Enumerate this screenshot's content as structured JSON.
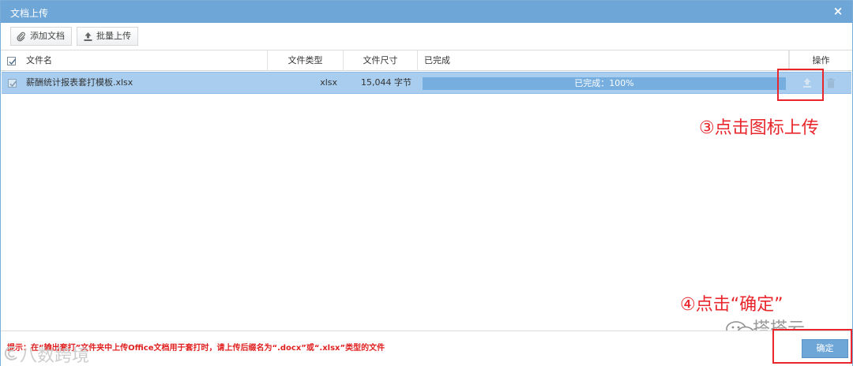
{
  "dialog": {
    "title": "文档上传",
    "close_glyph": "×"
  },
  "toolbar": {
    "add_label": "添加文档",
    "batch_label": "批量上传",
    "add_icon": "paperclip-icon",
    "batch_icon": "upload-icon"
  },
  "table": {
    "headers": {
      "name": "文件名",
      "type": "文件类型",
      "size": "文件尺寸",
      "done": "已完成",
      "ops": "操作"
    },
    "rows": [
      {
        "name": "薪酬统计报表套打模板.xlsx",
        "type": "xlsx",
        "size": "15,044 字节",
        "progress_label": "已完成：100%",
        "progress": 1.0,
        "checked": true
      }
    ]
  },
  "annotations": {
    "step3": "③点击图标上传",
    "step4": "④点击“确定”"
  },
  "footer": {
    "hint": "提示：在“输出套打”文件夹中上传Office文档用于套打时，请上传后缀名为“.docx”或“.xlsx”类型的文件",
    "ok_label": "确定"
  },
  "watermarks": {
    "wechat": "搭搭云",
    "bottom_left": "八数跨境"
  },
  "colors": {
    "titlebar": "#6ea6d8",
    "row_selected": "#a8cdee",
    "progress_fill": "#77aee0",
    "annotation": "#e8262b",
    "hint": "#e02020"
  }
}
